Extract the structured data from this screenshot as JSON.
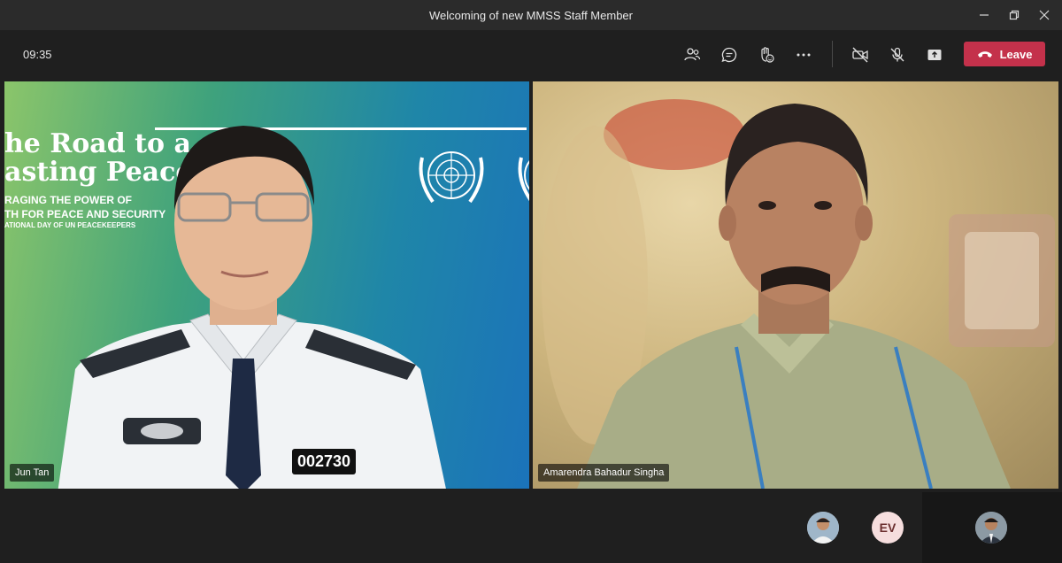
{
  "window": {
    "title": "Welcoming of new MMSS Staff Member"
  },
  "toolbar": {
    "clock": "09:35",
    "leave_label": "Leave",
    "icons": [
      "people-icon",
      "chat-icon",
      "raise-hand-icon",
      "more-icon",
      "camera-off-icon",
      "mic-off-icon",
      "share-tray-icon",
      "phone-hangup-icon"
    ]
  },
  "participants": {
    "left": {
      "name": "Jun Tan",
      "poster": {
        "line1": "he Road to a",
        "line2": "asting Peace",
        "sub1": "RAGING THE POWER OF",
        "sub2": "TH FOR PEACE AND SECURITY",
        "sub3": "ATIONAL DAY OF UN PEACEKEEPERS"
      },
      "badge_number": "002730"
    },
    "right": {
      "name": "Amarendra Bahadur Singha"
    }
  },
  "bottom": {
    "ev_initials": "EV"
  },
  "colors": {
    "leave": "#c4314b",
    "background": "#1f1f1f",
    "ev_avatar": "#f6dede"
  }
}
